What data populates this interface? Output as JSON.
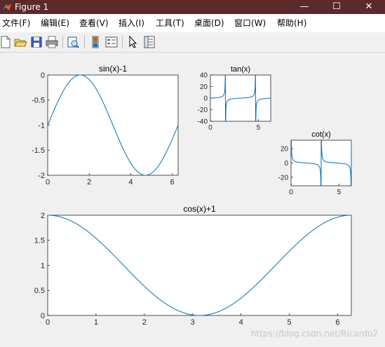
{
  "window": {
    "title": "Figure 1",
    "controls": [
      "—",
      "☐",
      "✕"
    ]
  },
  "menu": [
    {
      "label": "文件(F)"
    },
    {
      "label": "编辑(E)"
    },
    {
      "label": "查看(V)"
    },
    {
      "label": "插入(I)"
    },
    {
      "label": "工具(T)"
    },
    {
      "label": "桌面(D)"
    },
    {
      "label": "窗口(W)"
    },
    {
      "label": "帮助(H)"
    }
  ],
  "toolbar_icons": [
    "new-figure-icon",
    "open-file-icon",
    "save-icon",
    "print-icon",
    "print-preview-icon",
    "colorbar-icon",
    "legend-icon",
    "select-pointer-icon",
    "property-inspector-icon"
  ],
  "watermark": "https://blog.csdn.net/Ricardo2",
  "chart_data": [
    {
      "type": "line",
      "title": "sin(x)-1",
      "function": "sin(x)-1",
      "xlim": [
        0,
        6.2832
      ],
      "ylim": [
        -2,
        0
      ],
      "xticks": [
        0,
        2,
        4,
        6
      ],
      "yticks": [
        -2,
        -1.5,
        -1,
        -0.5,
        0
      ],
      "xticklabels": [
        "0",
        "2",
        "4",
        "6"
      ],
      "yticklabels": [
        "-2",
        "-1.5",
        "-1",
        "-0.5",
        "0"
      ],
      "color": "#0072bd",
      "grid": false
    },
    {
      "type": "line",
      "title": "tan(x)",
      "function": "tan(x)",
      "xlim": [
        0,
        6.2832
      ],
      "ylim": [
        -40,
        40
      ],
      "xticks": [
        0,
        5
      ],
      "yticks": [
        -40,
        -20,
        0,
        20,
        40
      ],
      "xticklabels": [
        "0",
        "5"
      ],
      "yticklabels": [
        "-40",
        "-20",
        "0",
        "20",
        "40"
      ],
      "color": "#0072bd",
      "grid": false
    },
    {
      "type": "line",
      "title": "cot(x)",
      "function": "cot(x)",
      "xlim": [
        0,
        6.2832
      ],
      "ylim": [
        -32,
        32
      ],
      "xticks": [
        0,
        5
      ],
      "yticks": [
        -20,
        0,
        20
      ],
      "xticklabels": [
        "0",
        "5"
      ],
      "yticklabels": [
        "-20",
        "0",
        "20"
      ],
      "color": "#0072bd",
      "grid": false
    },
    {
      "type": "line",
      "title": "cos(x)+1",
      "function": "cos(x)+1",
      "xlim": [
        0,
        6.2832
      ],
      "ylim": [
        0,
        2
      ],
      "xticks": [
        0,
        1,
        2,
        3,
        4,
        5,
        6
      ],
      "yticks": [
        0,
        0.5,
        1,
        1.5,
        2
      ],
      "xticklabels": [
        "0",
        "1",
        "2",
        "3",
        "4",
        "5",
        "6"
      ],
      "yticklabels": [
        "0",
        "0.5",
        "1",
        "1.5",
        "2"
      ],
      "color": "#0072bd",
      "grid": false
    }
  ]
}
